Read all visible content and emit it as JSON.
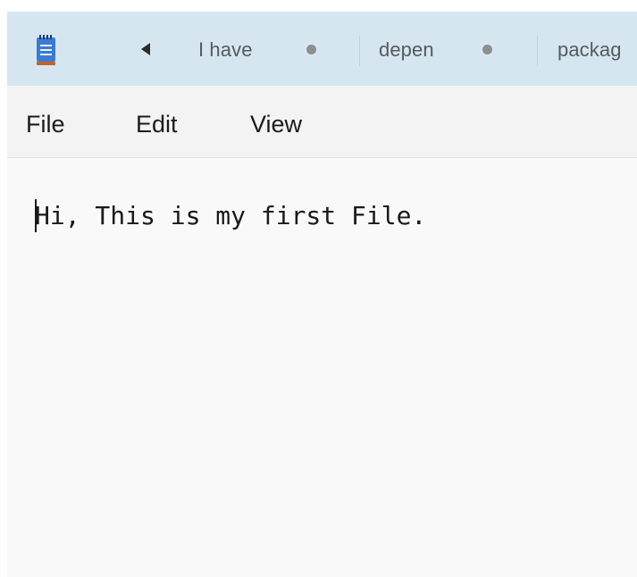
{
  "app": {
    "icon": "notepad-icon"
  },
  "tabs": {
    "scroll_left_icon": "triangle-left-icon",
    "items": [
      {
        "label": "I have",
        "modified": true
      },
      {
        "label": "depen",
        "modified": true
      },
      {
        "label": "packag",
        "modified": false
      }
    ]
  },
  "menu": {
    "file": "File",
    "edit": "Edit",
    "view": "View"
  },
  "editor": {
    "content": "Hi, This is my first File."
  },
  "colors": {
    "titlebar": "#d6e6f1",
    "menubar": "#f3f3f3",
    "editor_bg": "#f9f9f9",
    "icon_blue": "#3a7bd5",
    "icon_accent": "#c3622b"
  }
}
